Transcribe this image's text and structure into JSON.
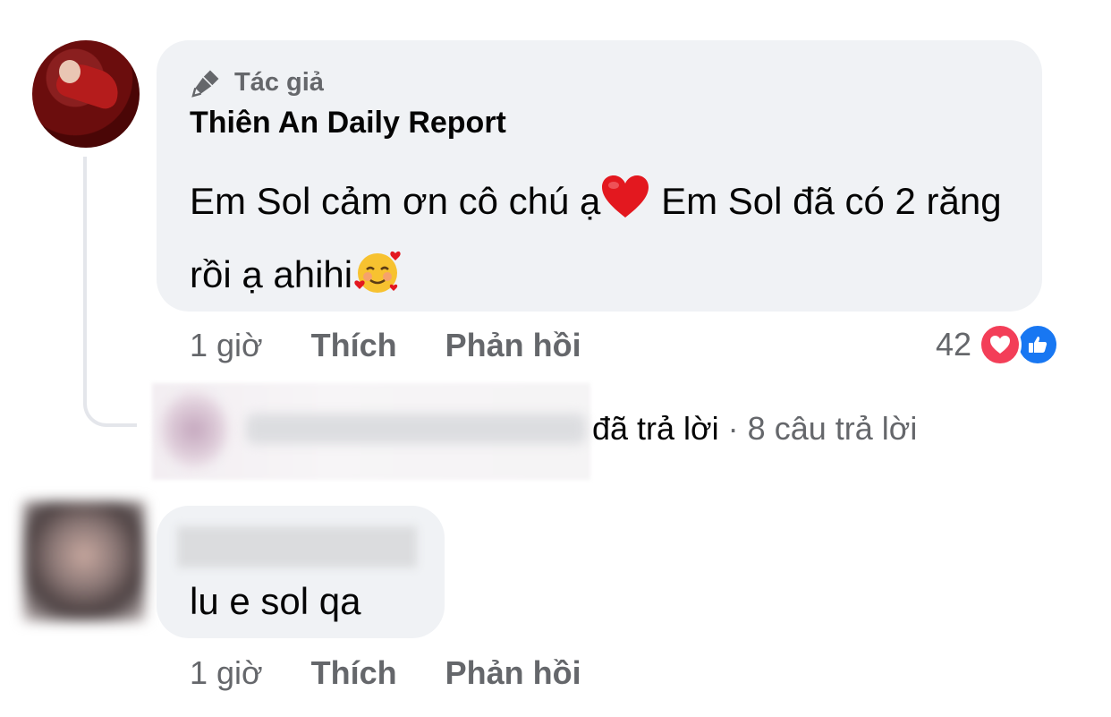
{
  "comment": {
    "author_badge": "Tác giả",
    "author_name": "Thiên An Daily Report",
    "text_part1": "Em Sol cảm ơn cô chú ạ",
    "text_part2": " Em Sol đã có 2 răng rồi ạ ahihi",
    "emoji_1": "red-heart-emoji",
    "emoji_2": "smiling-face-with-hearts-emoji",
    "time": "1 giờ",
    "like_label": "Thích",
    "reply_label": "Phản hồi",
    "reaction_count": "42",
    "reaction_icons": [
      "love-icon",
      "like-icon"
    ]
  },
  "replies_summary": {
    "replied_text": "đã trả lời",
    "separator": " · ",
    "count_text": "8 câu trả lời"
  },
  "comment2": {
    "text": "lu e sol qa",
    "time": "1 giờ",
    "like_label": "Thích",
    "reply_label": "Phản hồi"
  },
  "colors": {
    "bubble_bg": "#f0f2f5",
    "secondary_text": "#65676b",
    "love_red": "#f33e58",
    "like_blue": "#1877f2"
  }
}
